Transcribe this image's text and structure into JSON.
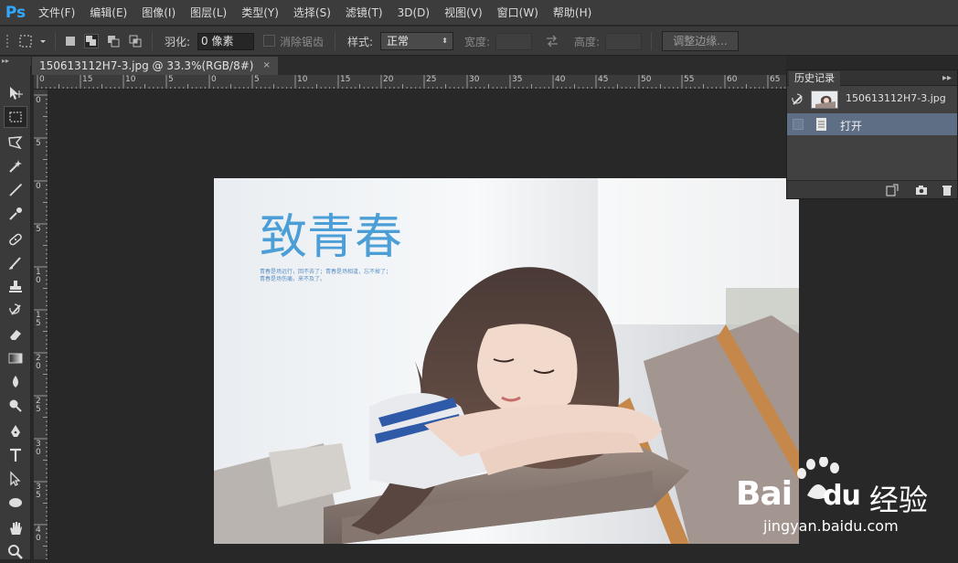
{
  "app": {
    "logo": "Ps"
  },
  "menu": [
    "文件(F)",
    "编辑(E)",
    "图像(I)",
    "图层(L)",
    "类型(Y)",
    "选择(S)",
    "滤镜(T)",
    "3D(D)",
    "视图(V)",
    "窗口(W)",
    "帮助(H)"
  ],
  "options": {
    "feather_label": "羽化:",
    "feather_value": "0 像素",
    "antialias_label": "消除锯齿",
    "style_label": "样式:",
    "style_value": "正常",
    "width_label": "宽度:",
    "height_label": "高度:",
    "refine_edge_label": "调整边缘..."
  },
  "document": {
    "tab_title": "150613112H7-3.jpg @ 33.3%(RGB/8#)",
    "close_glyph": "×"
  },
  "ruler": {
    "h_ticks": [
      "0",
      "15",
      "10",
      "5",
      "0",
      "5",
      "10",
      "15",
      "20",
      "25",
      "30",
      "35",
      "40",
      "45",
      "50",
      "55",
      "60",
      "65"
    ],
    "v_ticks": [
      "0",
      "5",
      "0",
      "5",
      "1\n0",
      "1\n5",
      "2\n0",
      "2\n5",
      "3\n0",
      "3\n5",
      "4\n0"
    ]
  },
  "photo": {
    "title_text": "致青春",
    "caption_line1": "青春是场远行，回不去了；青春是场相逢，忘不掉了；",
    "caption_line2": "青春是场伤痛，来不及了。"
  },
  "history": {
    "panel_title": "历史记录",
    "snapshot_label": "150613112H7-3.jpg",
    "step_open": "打开"
  },
  "watermark": {
    "brand": "Bai",
    "brand2": "du",
    "cn": "经验",
    "url": "jingyan.baidu.com"
  },
  "tools": [
    "move-icon",
    "marquee-icon",
    "lasso-icon",
    "magic-wand-icon",
    "crop-icon",
    "eyedropper-icon",
    "healing-brush-icon",
    "brush-icon",
    "clone-stamp-icon",
    "history-brush-icon",
    "eraser-icon",
    "gradient-icon",
    "blur-icon",
    "dodge-icon",
    "pen-icon",
    "type-icon",
    "path-select-icon",
    "ellipse-icon",
    "hand-icon",
    "zoom-icon"
  ],
  "colors": {
    "accent": "#31a8ff",
    "panel": "#414141",
    "selected_row": "#5d6e85"
  }
}
